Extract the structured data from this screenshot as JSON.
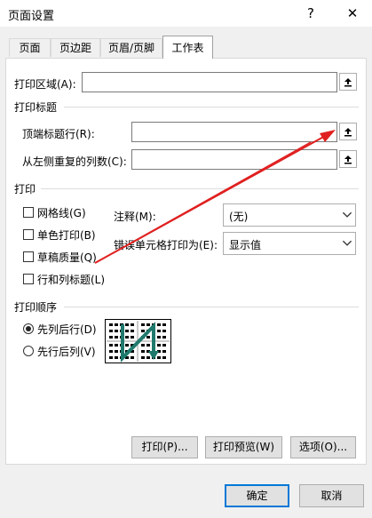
{
  "dialog": {
    "title": "页面设置",
    "help": "?",
    "close": "✕"
  },
  "tabs": [
    "页面",
    "页边距",
    "页眉/页脚",
    "工作表"
  ],
  "print_area": {
    "label": "打印区域(A):"
  },
  "print_titles": {
    "section": "打印标题",
    "rows_label": "顶端标题行(R):",
    "cols_label": "从左侧重复的列数(C):"
  },
  "print": {
    "section": "打印",
    "gridlines": "网格线(G)",
    "mono": "单色打印(B)",
    "draft": "草稿质量(Q)",
    "headings": "行和列标题(L)",
    "comments_label": "注释(M):",
    "comments_value": "(无)",
    "errors_label": "错误单元格打印为(E):",
    "errors_value": "显示值"
  },
  "order": {
    "section": "打印顺序",
    "down_then_over": "先列后行(D)",
    "over_then_down": "先行后列(V)",
    "selected": "down_then_over"
  },
  "buttons": {
    "print": "打印(P)...",
    "preview": "打印预览(W)",
    "options": "选项(O)...",
    "ok": "确定",
    "cancel": "取消"
  },
  "colors": {
    "annotation_arrow": "#e02020",
    "accent": "#0078d7",
    "order_arrow": "#1f7a6d"
  }
}
